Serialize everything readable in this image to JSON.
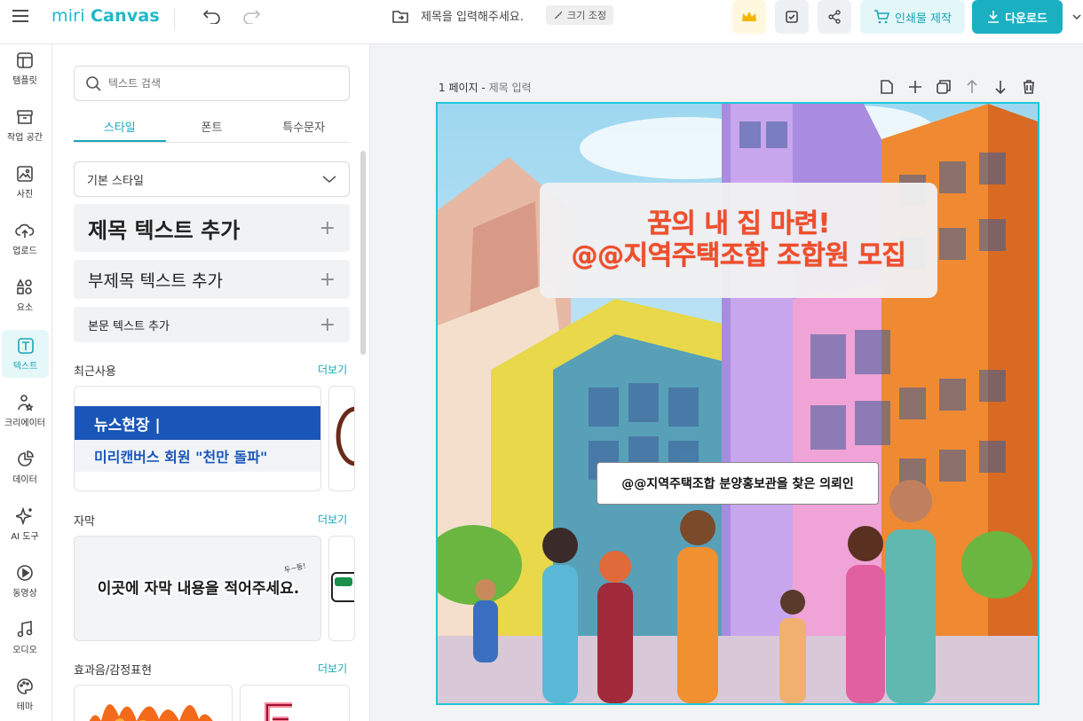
{
  "header": {
    "logo_light": "miri",
    "logo_bold": "Canvas",
    "title_placeholder": "제목을 입력해주세요.",
    "resize_label": "크기 조정",
    "print_label": "인쇄물 제작",
    "download_label": "다운로드"
  },
  "rail": {
    "items": [
      {
        "label": "템플릿",
        "icon": "template-icon"
      },
      {
        "label": "작업 공간",
        "icon": "archive-icon"
      },
      {
        "label": "사진",
        "icon": "photo-icon"
      },
      {
        "label": "업로드",
        "icon": "upload-icon"
      },
      {
        "label": "요소",
        "icon": "elements-icon"
      },
      {
        "label": "텍스트",
        "icon": "text-icon"
      },
      {
        "label": "크리에이터",
        "icon": "creator-icon"
      },
      {
        "label": "데이터",
        "icon": "chart-icon"
      },
      {
        "label": "AI 도구",
        "icon": "sparkle-icon"
      },
      {
        "label": "동영상",
        "icon": "play-icon"
      },
      {
        "label": "오디오",
        "icon": "music-icon"
      },
      {
        "label": "테마",
        "icon": "palette-icon"
      }
    ]
  },
  "panel": {
    "search_placeholder": "텍스트 검색",
    "tabs": [
      "스타일",
      "폰트",
      "특수문자"
    ],
    "style_select": "기본 스타일",
    "add_title": "제목 텍스트 추가",
    "add_subtitle": "부제목 텍스트 추가",
    "add_body": "본문 텍스트 추가",
    "recent_title": "최근사용",
    "caption_title": "자막",
    "effects_title": "효과음/감정표현",
    "more": "더보기",
    "recent_card_line1": "뉴스현장 |",
    "recent_card_line2": "미리캔버스 회원 \"천만 돌파\"",
    "caption_card_text": "이곳에 자막 내용을 적어주세요.",
    "caption_card_tag": "두~둥!"
  },
  "workspace": {
    "page_number": "1 페이지",
    "page_title": "제목 입력",
    "headline_1": "꿈의 내 집 마련!",
    "headline_2": "@@지역주택조합 조합원 모집",
    "caption": "@@지역주택조합 분양홍보관을 찾은 의뢰인"
  },
  "colors": {
    "accent": "#1ab0c2",
    "headline": "#f04e2a",
    "crown": "#f2b600"
  }
}
